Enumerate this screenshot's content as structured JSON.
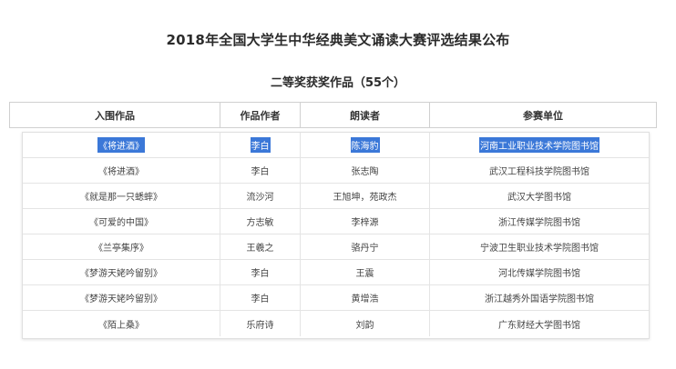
{
  "page": {
    "title": "2018年全国大学生中华经典美文诵读大赛评选结果公布",
    "subtitle": "二等奖获奖作品（55个）"
  },
  "table": {
    "headers": [
      "入围作品",
      "作品作者",
      "朗读者",
      "参赛单位"
    ],
    "rows": [
      {
        "work": "《将进酒》",
        "author": "李白",
        "reader": "陈海豹",
        "unit": "河南工业职业技术学院图书馆",
        "selected": true
      },
      {
        "work": "《将进酒》",
        "author": "李白",
        "reader": "张志陶",
        "unit": "武汉工程科技学院图书馆",
        "selected": false
      },
      {
        "work": "《就是那一只蟋蟀》",
        "author": "流沙河",
        "reader": "王旭坤，苑政杰",
        "unit": "武汉大学图书馆",
        "selected": false
      },
      {
        "work": "《可爱的中国》",
        "author": "方志敏",
        "reader": "李梓源",
        "unit": "浙江传媒学院图书馆",
        "selected": false
      },
      {
        "work": "《兰亭集序》",
        "author": "王羲之",
        "reader": "骆丹宁",
        "unit": "宁波卫生职业技术学院图书馆",
        "selected": false
      },
      {
        "work": "《梦游天姥吟留别》",
        "author": "李白",
        "reader": "王震",
        "unit": "河北传媒学院图书馆",
        "selected": false
      },
      {
        "work": "《梦游天姥吟留别》",
        "author": "李白",
        "reader": "黄增浩",
        "unit": "浙江越秀外国语学院图书馆",
        "selected": false
      },
      {
        "work": "《陌上桑》",
        "author": "乐府诗",
        "reader": "刘韵",
        "unit": "广东财经大学图书馆",
        "selected": false
      }
    ]
  },
  "colors": {
    "selection": "#3b78d8",
    "border": "#d0d0d0"
  }
}
